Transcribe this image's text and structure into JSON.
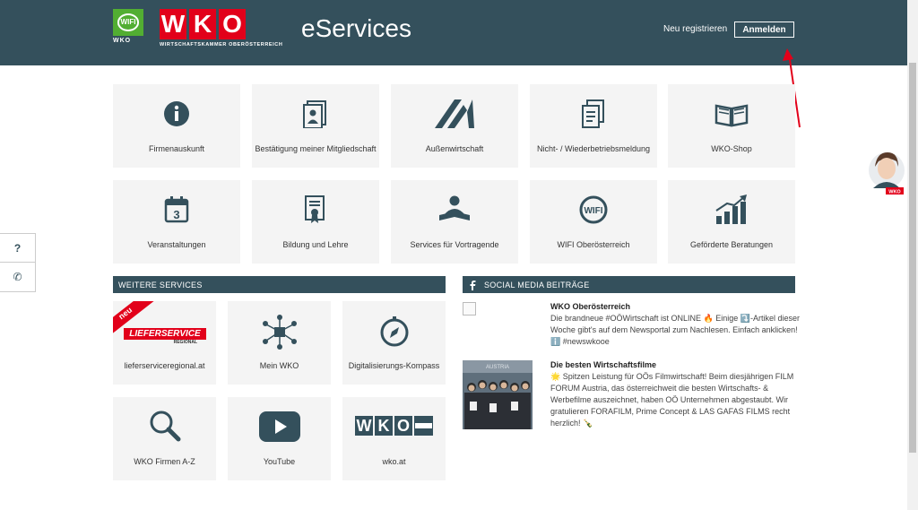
{
  "header": {
    "wifi_logo": "WIFI",
    "wifi_sub": "WKO",
    "wko_letters": [
      "W",
      "K",
      "O"
    ],
    "wko_sub": "WIRTSCHAFTSKAMMER OBERÖSTERREICH",
    "title": "eServices",
    "register_label": "Neu registrieren",
    "login_label": "Anmelden"
  },
  "tiles_top": [
    {
      "label": "Firmenauskunft",
      "icon": "info-icon"
    },
    {
      "label": "Bestätigung meiner Mitgliedschaft",
      "icon": "membership-icon"
    },
    {
      "label": "Außenwirtschaft",
      "icon": "trade-icon"
    },
    {
      "label": "Nicht- / Wiederbetriebsmeldung",
      "icon": "documents-icon"
    },
    {
      "label": "WKO-Shop",
      "icon": "book-icon"
    },
    {
      "label": "Veranstaltungen",
      "icon": "calendar-icon",
      "icon_text": "3"
    },
    {
      "label": "Bildung und Lehre",
      "icon": "certificate-icon"
    },
    {
      "label": "Services für Vortragende",
      "icon": "presenter-icon"
    },
    {
      "label": "WIFI Oberösterreich",
      "icon": "wifi-icon",
      "icon_text": "WIFI"
    },
    {
      "label": "Geförderte Beratungen",
      "icon": "growth-chart-icon"
    }
  ],
  "more_services": {
    "heading": "WEITERE SERVICES",
    "badge": "neu",
    "lieferservice_logo": "LIEFERSERVICE",
    "lieferservice_sub": "REGIONAL",
    "wko_logo_letters": [
      "W",
      "K",
      "O"
    ],
    "tiles": [
      {
        "label": "lieferserviceregional.at",
        "icon": "lieferservice-logo"
      },
      {
        "label": "Mein WKO",
        "icon": "network-icon"
      },
      {
        "label": "Digitalisierungs-Kompass",
        "icon": "compass-icon"
      },
      {
        "label": "WKO Firmen A-Z",
        "icon": "magnifier-icon"
      },
      {
        "label": "YouTube",
        "icon": "youtube-icon"
      },
      {
        "label": "wko.at",
        "icon": "wko-logo"
      }
    ]
  },
  "social": {
    "heading": "SOCIAL MEDIA BEITRÄGE",
    "posts": [
      {
        "title": "WKO Oberösterreich",
        "lines": [
          "Die brandneue #OÖWirtschaft ist ONLINE 🔥 Einige ⤵️-Artikel dieser",
          "Woche gibt's auf dem Newsportal zum Nachlesen. Einfach anklicken!",
          "ℹ️ #newswkooe"
        ]
      },
      {
        "title": "Die besten Wirtschaftsfilme",
        "lines": [
          "🌟 Spitzen Leistung für OÖs Filmwirtschaft! Beim diesjährigen FILM",
          "FORUM Austria, das österreichweit die besten Wirtschafts- &",
          "Werbefilme auszeichnet, haben OÖ Unternehmen abgestaubt. Wir",
          "gratulieren FORAFILM, Prime Concept & LAS GAFAS FILMS recht",
          "herzlich! 🍾"
        ],
        "photo_text": "AUSTRIA"
      }
    ]
  },
  "side_widget": {
    "help": "?",
    "phone": "✆"
  },
  "avatar_badge": "WKO",
  "colors": {
    "header": "#34505c",
    "brand_red": "#e2001a",
    "wifi_green": "#52ae32",
    "tile_bg": "#f4f4f4"
  }
}
